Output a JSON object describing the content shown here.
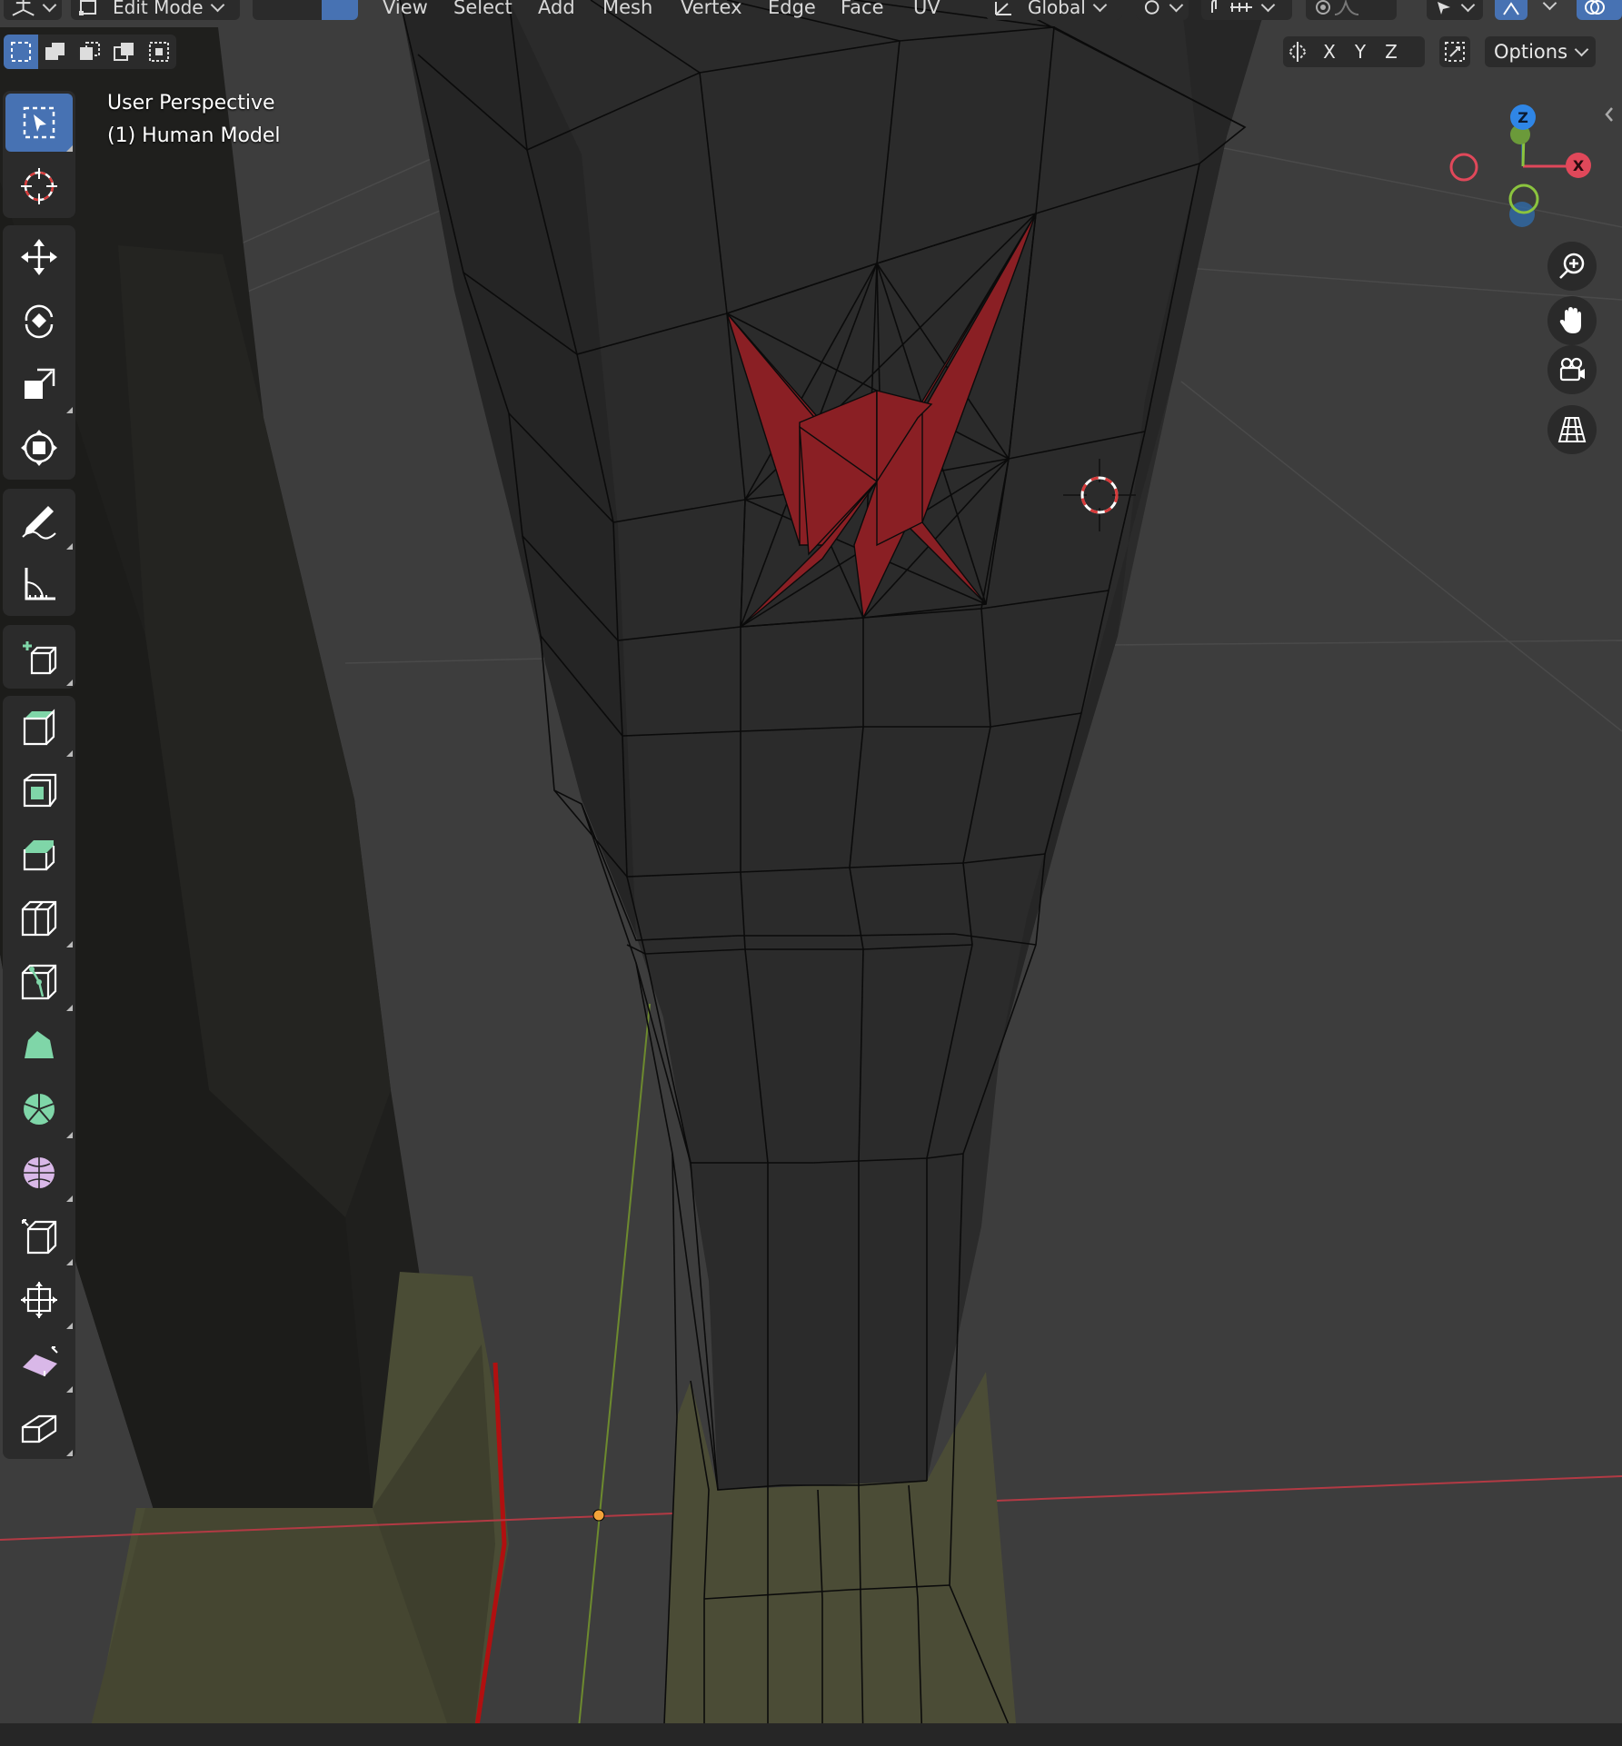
{
  "header": {
    "editor_type_icon": "3d-viewport-icon",
    "mode_label": "Edit Mode",
    "menus": [
      "View",
      "Select",
      "Add",
      "Mesh",
      "Vertex",
      "Edge",
      "Face",
      "UV"
    ],
    "transform_orientation": "Global"
  },
  "viewport": {
    "perspective_label": "User Perspective",
    "object_label": "(1) Human Model"
  },
  "axis_toggles": [
    "X",
    "Y",
    "Z"
  ],
  "options_label": "Options",
  "gizmo": {
    "z_label": "Z",
    "x_label": "X",
    "colors": {
      "x": "#e0485a",
      "y": "#8bc43e",
      "z": "#2f86e6"
    }
  },
  "toolbar": {
    "tools": [
      "select-box-tool",
      "cursor-tool",
      "move-tool",
      "rotate-tool",
      "scale-tool",
      "transform-tool",
      "annotate-tool",
      "measure-tool",
      "add-cube-tool",
      "extrude-region-tool",
      "inset-faces-tool",
      "bevel-tool",
      "loop-cut-tool",
      "knife-tool",
      "poly-build-tool",
      "spin-tool",
      "smooth-tool",
      "edge-slide-tool",
      "shrink-fatten-tool",
      "shear-tool",
      "rip-region-tool"
    ]
  },
  "colors": {
    "accent": "#4772b3",
    "selected_face": "#8a1f24",
    "background": "#3d3d3d"
  }
}
